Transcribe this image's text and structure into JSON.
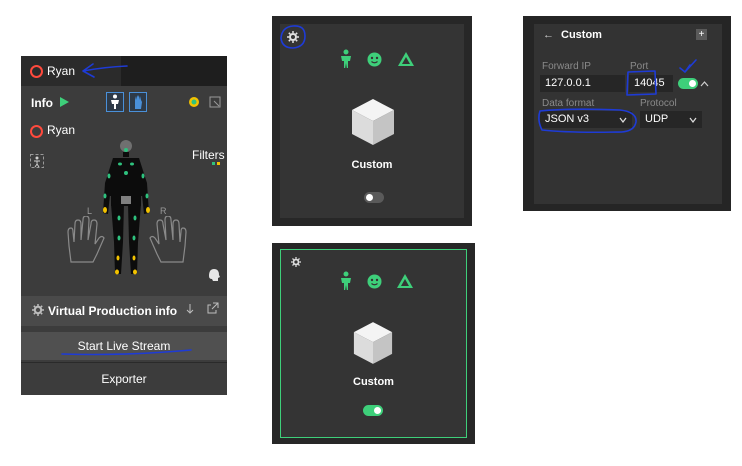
{
  "left_panel": {
    "header_user": "Ryan",
    "info_label": "Info",
    "actor_user": "Ryan",
    "filters_label": "Filters",
    "hand_left_label": "L",
    "hand_right_label": "R",
    "vp_info_label": "Virtual Production info",
    "start_live_stream_label": "Start Live Stream",
    "exporter_label": "Exporter"
  },
  "device_card_off": {
    "device_name": "Custom",
    "toggle_on": false
  },
  "device_card_on": {
    "device_name": "Custom",
    "toggle_on": true
  },
  "custom_panel": {
    "title": "Custom",
    "forward_ip_label": "Forward IP",
    "forward_ip_value": "127.0.0.1",
    "port_label": "Port",
    "port_value": "14045",
    "data_format_label": "Data format",
    "data_format_value": "JSON v3",
    "protocol_label": "Protocol",
    "protocol_value": "UDP",
    "toggle_on": true
  },
  "colors": {
    "accent_green": "#3ecf7a",
    "record_red": "#ff4a3d",
    "body_blue": "#4a90d9",
    "annotation_blue": "#1e3bd6",
    "sensor_green": "#2ec27e",
    "sensor_yellow": "#f2c200"
  }
}
